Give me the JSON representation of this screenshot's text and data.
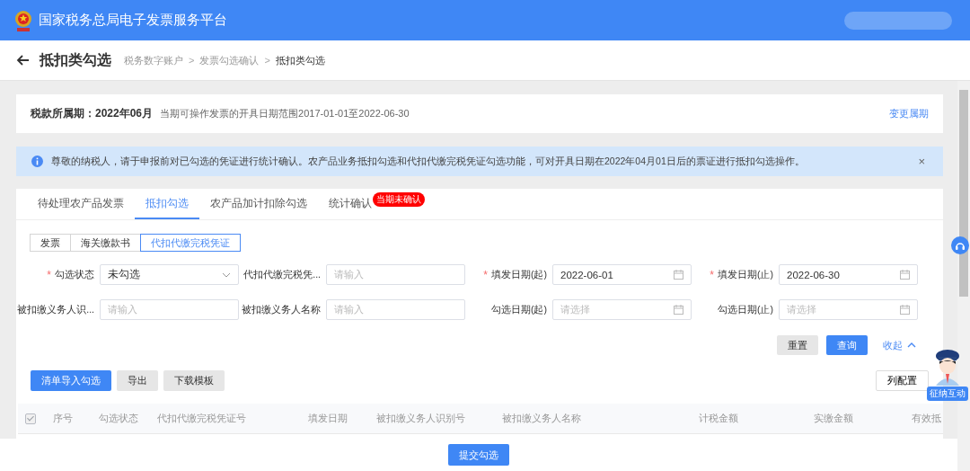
{
  "header": {
    "title": "国家税务总局电子发票服务平台"
  },
  "page": {
    "title": "抵扣类勾选",
    "separator": ">",
    "breadcrumb": [
      {
        "label": "税务数字账户",
        "current": false
      },
      {
        "label": "发票勾选确认",
        "current": false
      },
      {
        "label": "抵扣类勾选",
        "current": true
      }
    ]
  },
  "period": {
    "label": "税款所属期：2022年06月",
    "range": "当期可操作发票的开具日期范围2017-01-01至2022-06-30",
    "action": "变更属期"
  },
  "notice": {
    "text": "尊敬的纳税人，请于申报前对已勾选的凭证进行统计确认。农产品业务抵扣勾选和代扣代缴完税凭证勾选功能，可对开具日期在2022年04月01日后的票证进行抵扣勾选操作。",
    "close": "×"
  },
  "tabs": [
    {
      "label": "待处理农产品发票",
      "selected": false
    },
    {
      "label": "抵扣勾选",
      "selected": true
    },
    {
      "label": "农产品加计扣除勾选",
      "selected": false
    },
    {
      "label": "统计确认",
      "selected": false,
      "badge": "当期未确认"
    }
  ],
  "subtabs": [
    {
      "label": "发票",
      "selected": false
    },
    {
      "label": "海关缴款书",
      "selected": false
    },
    {
      "label": "代扣代缴完税凭证",
      "selected": true
    }
  ],
  "required_mark": "*",
  "filters": [
    {
      "kind": "select",
      "label": "勾选状态",
      "required": true,
      "value": "未勾选"
    },
    {
      "kind": "text",
      "label": "代扣代缴完税凭...",
      "required": false,
      "placeholder": "请输入"
    },
    {
      "kind": "date",
      "label": "填发日期(起)",
      "required": true,
      "value": "2022-06-01"
    },
    {
      "kind": "date",
      "label": "填发日期(止)",
      "required": true,
      "value": "2022-06-30"
    },
    {
      "kind": "text",
      "label": "被扣缴义务人识...",
      "required": false,
      "placeholder": "请输入"
    },
    {
      "kind": "text",
      "label": "被扣缴义务人名称",
      "required": false,
      "placeholder": "请输入"
    },
    {
      "kind": "date",
      "label": "勾选日期(起)",
      "required": false,
      "placeholder": "请选择"
    },
    {
      "kind": "date",
      "label": "勾选日期(止)",
      "required": false,
      "placeholder": "请选择"
    }
  ],
  "filter_actions": {
    "reset": "重置",
    "query": "查询",
    "collapse": "收起"
  },
  "toolbar": [
    {
      "label": "清单导入勾选",
      "kind": "primary"
    },
    {
      "label": "导出",
      "kind": "default"
    },
    {
      "label": "下载模板",
      "kind": "default"
    }
  ],
  "column_config": "列配置",
  "table": {
    "select_all": {
      "checked": true,
      "disabled": true
    },
    "columns": [
      "序号",
      "勾选状态",
      "代扣代缴完税凭证号",
      "填发日期",
      "被扣缴义务人识别号",
      "被扣缴义务人名称",
      "计税金额",
      "实缴金额",
      "有效抵"
    ]
  },
  "submit": "提交勾选",
  "assistant": {
    "label": "征纳互动"
  }
}
